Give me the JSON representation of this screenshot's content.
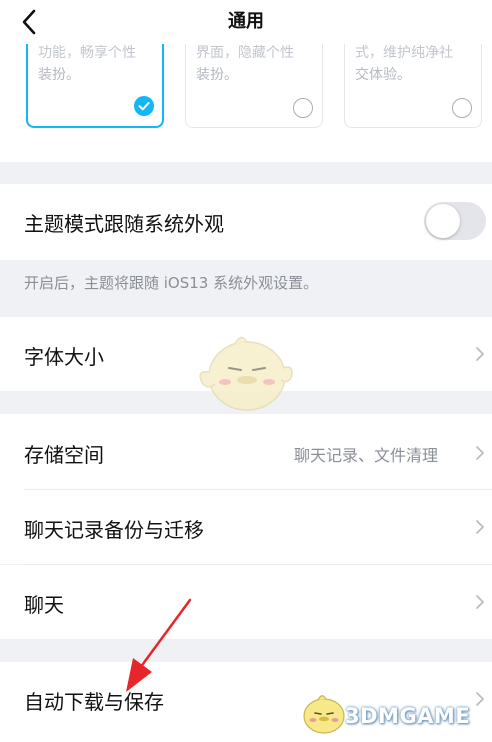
{
  "nav": {
    "title": "通用",
    "back_icon": "chevron-left-icon"
  },
  "theme_cards": [
    {
      "line1": "功能，畅享个性",
      "line2": "装扮。",
      "selected": true
    },
    {
      "line1": "界面，隐藏个性",
      "line2": "装扮。",
      "selected": false
    },
    {
      "line1": "式，维护纯净社",
      "line2": "交体验。",
      "selected": false
    }
  ],
  "follow_system": {
    "label": "主题模式跟随系统外观",
    "enabled": false,
    "hint": "开启后，主题将跟随 iOS13 系统外观设置。"
  },
  "font_size": {
    "label": "字体大小"
  },
  "storage": {
    "label": "存储空间",
    "value": "聊天记录、文件清理"
  },
  "backup": {
    "label": "聊天记录备份与迁移"
  },
  "chat": {
    "label": "聊天"
  },
  "auto_download": {
    "label": "自动下载与保存"
  },
  "watermark": {
    "text": "3DMGAME"
  },
  "colors": {
    "accent": "#12b7f5",
    "background": "#f0f1f5",
    "annotation_arrow": "#e6262b"
  }
}
